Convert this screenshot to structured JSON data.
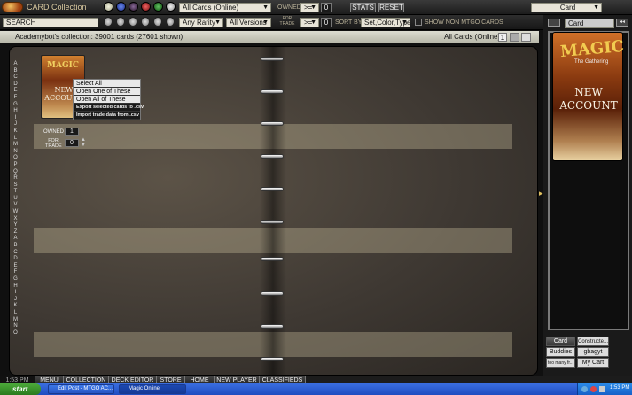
{
  "titlebar": {
    "app_title": "CARD Collection"
  },
  "filters": {
    "card_set": "All Cards (Online)",
    "owned_label": "OWNED",
    "owned_op": ">=",
    "owned_value": "0",
    "rarity": "Any Rarity",
    "versions": "All Versions",
    "for_trade_label": "FOR TRADE",
    "trade_op": ">=",
    "trade_value": "0",
    "sort_label": "SORT BY",
    "sort_value": "Set,Color,Type",
    "show_non_mtgo": "SHOW NON MTGO CARDS",
    "search_label": "SEARCH",
    "search_value": ""
  },
  "buttons": {
    "stats": "STATS",
    "reset": "RESET"
  },
  "right_panel": {
    "view_select": "Card",
    "search_value": "Card"
  },
  "status": {
    "collection_text": "Academybot's collection: 39001 cards (27601 shown)",
    "scope": "All Cards (Online)",
    "page_num": "1"
  },
  "binder": {
    "owned_label": "OWNED",
    "owned_value": "1",
    "for_trade_label": "FOR TRADE",
    "trade_value": "0",
    "letters": [
      "A",
      "B",
      "C",
      "D",
      "E",
      "F",
      "G",
      "H",
      "I",
      "J",
      "K",
      "L",
      "M",
      "N",
      "O",
      "P",
      "Q",
      "R",
      "S",
      "T",
      "U",
      "V",
      "W",
      "X",
      "Y",
      "Z",
      "A",
      "B",
      "C",
      "D",
      "E",
      "F",
      "G",
      "H",
      "I",
      "J",
      "K",
      "L",
      "M",
      "N",
      "O"
    ]
  },
  "pack": {
    "brand": "MAGIC",
    "subtitle": "The Gathering",
    "line1": "NEW",
    "line2": "ACCOUNT"
  },
  "context_menu": {
    "items": [
      "Select All",
      "Open One of These",
      "Open All of These",
      "Export selected cards to .csv",
      "Import trade data from .csv"
    ]
  },
  "right_tabs": {
    "card": "Card",
    "constructed": "Constructe...",
    "buddies": "Buddies",
    "user": "gbagyt",
    "too_many": "too many fr...",
    "my_cart": "My Cart"
  },
  "nav": {
    "time": "1:53 PM",
    "menu": "MENU",
    "collection": "COLLECTION",
    "deck_editor": "DECK EDITOR",
    "store": "STORE",
    "home": "HOME",
    "new_player": "NEW PLAYER",
    "classifieds": "CLASSIFIEDS"
  },
  "taskbar": {
    "start": "start",
    "task1": "Edit Post - MTGO AC...",
    "task2": "Magic Online",
    "clock": "1:53 PM"
  },
  "colors": {
    "mana_white": "#d8d8c8",
    "mana_blue": "#3050c0",
    "mana_black": "#503060",
    "mana_red": "#c02020",
    "mana_green": "#208030"
  }
}
